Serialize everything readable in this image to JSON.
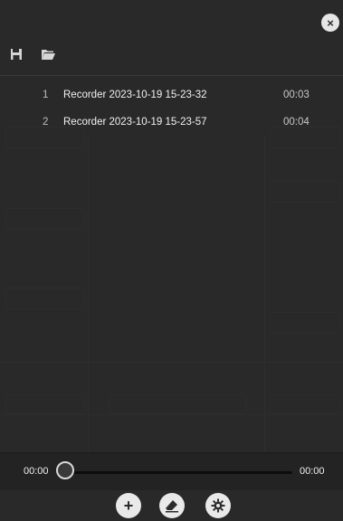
{
  "close_label": "×",
  "toolbar": {
    "save_icon": "save-icon",
    "open_icon": "folder-open-icon"
  },
  "recordings": [
    {
      "index": "1",
      "name": "Recorder 2023-10-19 15-23-32",
      "duration": "00:03"
    },
    {
      "index": "2",
      "name": "Recorder 2023-10-19 15-23-57",
      "duration": "00:04"
    }
  ],
  "player": {
    "current_time": "00:00",
    "total_time": "00:00",
    "progress": 0
  },
  "actions": {
    "add_label": "+",
    "add_icon": "plus-icon",
    "clear_icon": "eraser-icon",
    "settings_icon": "gear-icon"
  }
}
